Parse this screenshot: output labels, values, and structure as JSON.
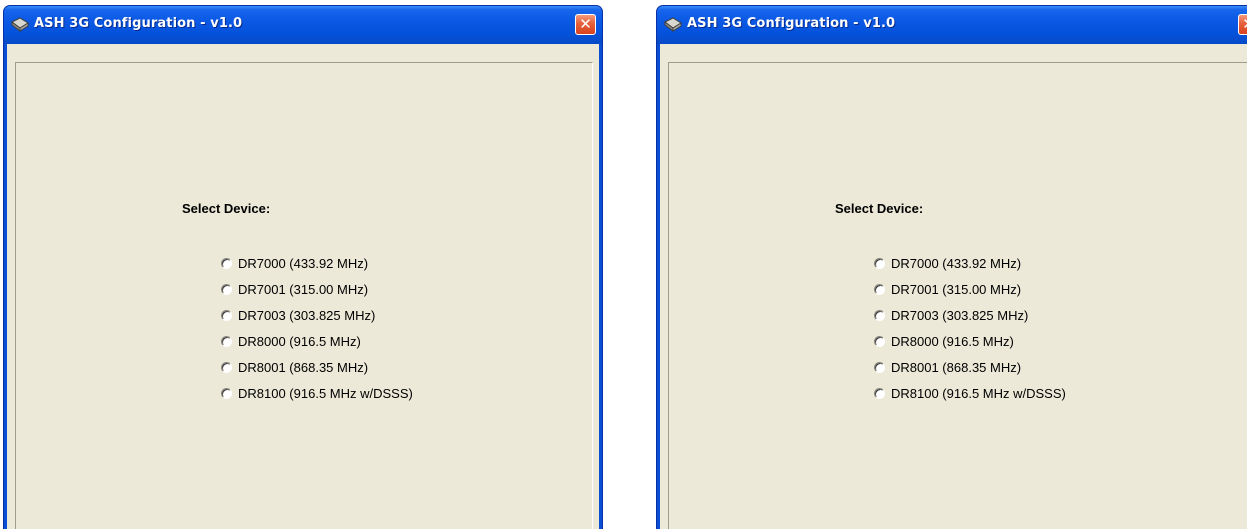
{
  "windows": [
    {
      "title": "ASH 3G Configuration - v1.0",
      "close_label": "✕",
      "prompt": "Select Device:",
      "devices": [
        "DR7000 (433.92 MHz)",
        "DR7001 (315.00 MHz)",
        "DR7003 (303.825 MHz)",
        "DR8000 (916.5 MHz)",
        "DR8001 (868.35 MHz)",
        "DR8100 (916.5 MHz w/DSSS)"
      ]
    },
    {
      "title": "ASH 3G Configuration - v1.0",
      "close_label": "✕",
      "prompt": "Select Device:",
      "devices": [
        "DR7000 (433.92 MHz)",
        "DR7001 (315.00 MHz)",
        "DR7003 (303.825 MHz)",
        "DR8000 (916.5 MHz)",
        "DR8001 (868.35 MHz)",
        "DR8100 (916.5 MHz w/DSSS)"
      ]
    }
  ],
  "icons": {
    "app": "app-icon",
    "close": "close-icon",
    "radio": "radio-unchecked-icon"
  },
  "colors": {
    "titlebar": "#0553dc",
    "window_face": "#ece9d8",
    "close_button": "#e5603a",
    "title_text": "#ffffff"
  }
}
